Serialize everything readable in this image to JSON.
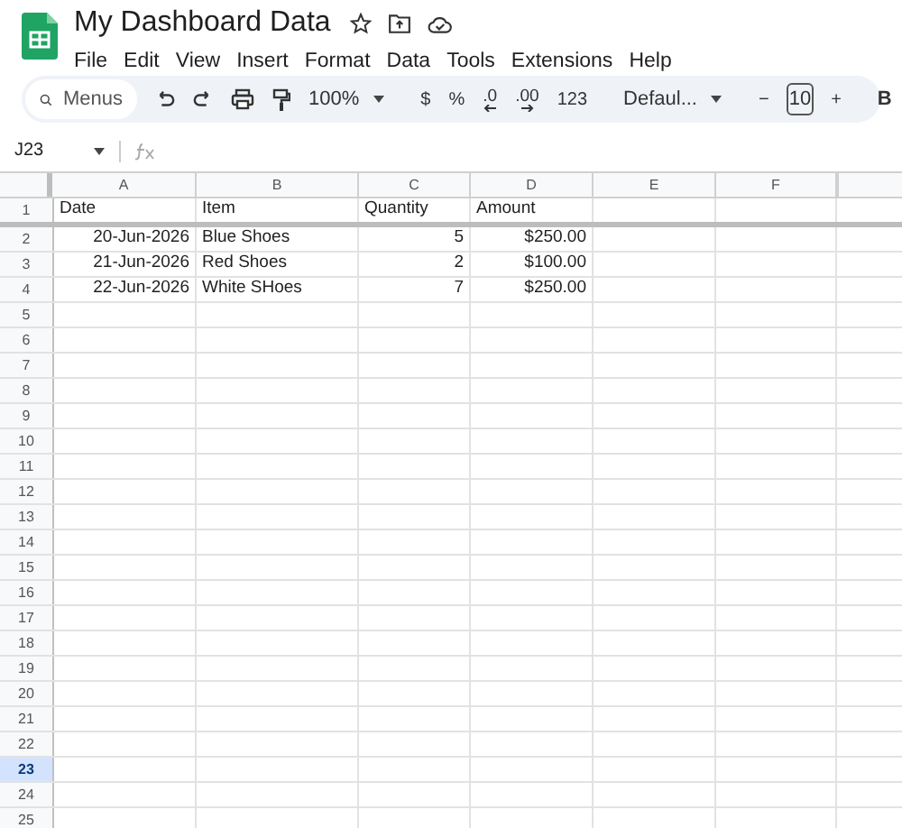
{
  "window": {
    "title": "My Dashboard Data"
  },
  "menu": [
    "File",
    "Edit",
    "View",
    "Insert",
    "Format",
    "Data",
    "Tools",
    "Extensions",
    "Help"
  ],
  "toolbar": [
    {
      "kind": "search",
      "text": "Menus"
    },
    {
      "kind": "undo"
    },
    {
      "kind": "redo"
    },
    {
      "kind": "print"
    },
    {
      "kind": "paint"
    },
    {
      "kind": "dropdown",
      "text": "100%"
    },
    {
      "kind": "sep"
    },
    {
      "kind": "text",
      "text": "$"
    },
    {
      "kind": "text",
      "text": "%"
    },
    {
      "kind": "decimal-down",
      "text": ".0"
    },
    {
      "kind": "decimal-up",
      "text": ".00"
    },
    {
      "kind": "text",
      "text": "123"
    },
    {
      "kind": "sep"
    },
    {
      "kind": "dropdown",
      "text": "Defaul..."
    },
    {
      "kind": "sep"
    },
    {
      "kind": "text",
      "text": "−"
    },
    {
      "kind": "field",
      "text": "10"
    },
    {
      "kind": "text",
      "text": "+"
    },
    {
      "kind": "sep"
    },
    {
      "kind": "bold",
      "text": "B"
    }
  ],
  "name_box": "J23",
  "columns": [
    "A",
    "B",
    "C",
    "D",
    "E",
    "F"
  ],
  "rows": [
    {
      "number": "1",
      "selected": false,
      "cells": [
        {
          "kind": "text",
          "text": "Date"
        },
        {
          "kind": "text",
          "text": "Item"
        },
        {
          "kind": "text",
          "text": "Quantity"
        },
        {
          "kind": "text",
          "text": "Amount"
        }
      ]
    },
    {
      "number": "2",
      "selected": false,
      "cells": [
        {
          "kind": "number",
          "text": "20-Jun-2026"
        },
        {
          "kind": "text",
          "text": "Blue Shoes"
        },
        {
          "kind": "number",
          "text": "5"
        },
        {
          "kind": "number",
          "text": "$250.00"
        }
      ]
    },
    {
      "number": "3",
      "selected": false,
      "cells": [
        {
          "kind": "number",
          "text": "21-Jun-2026"
        },
        {
          "kind": "text",
          "text": "Red Shoes"
        },
        {
          "kind": "number",
          "text": "2"
        },
        {
          "kind": "number",
          "text": "$100.00"
        }
      ]
    },
    {
      "number": "4",
      "selected": false,
      "cells": [
        {
          "kind": "number",
          "text": "22-Jun-2026"
        },
        {
          "kind": "text",
          "text": "White SHoes"
        },
        {
          "kind": "number",
          "text": "7"
        },
        {
          "kind": "number",
          "text": "$250.00"
        }
      ]
    },
    {
      "number": "5",
      "selected": false,
      "cells": []
    },
    {
      "number": "6",
      "selected": false,
      "cells": []
    },
    {
      "number": "7",
      "selected": false,
      "cells": []
    },
    {
      "number": "8",
      "selected": false,
      "cells": []
    },
    {
      "number": "9",
      "selected": false,
      "cells": []
    },
    {
      "number": "10",
      "selected": false,
      "cells": []
    },
    {
      "number": "11",
      "selected": false,
      "cells": []
    },
    {
      "number": "12",
      "selected": false,
      "cells": []
    },
    {
      "number": "13",
      "selected": false,
      "cells": []
    },
    {
      "number": "14",
      "selected": false,
      "cells": []
    },
    {
      "number": "15",
      "selected": false,
      "cells": []
    },
    {
      "number": "16",
      "selected": false,
      "cells": []
    },
    {
      "number": "17",
      "selected": false,
      "cells": []
    },
    {
      "number": "18",
      "selected": false,
      "cells": []
    },
    {
      "number": "19",
      "selected": false,
      "cells": []
    },
    {
      "number": "20",
      "selected": false,
      "cells": []
    },
    {
      "number": "21",
      "selected": false,
      "cells": []
    },
    {
      "number": "22",
      "selected": false,
      "cells": []
    },
    {
      "number": "23",
      "selected": true,
      "cells": []
    },
    {
      "number": "24",
      "selected": false,
      "cells": []
    },
    {
      "number": "25",
      "selected": false,
      "cells": []
    }
  ]
}
